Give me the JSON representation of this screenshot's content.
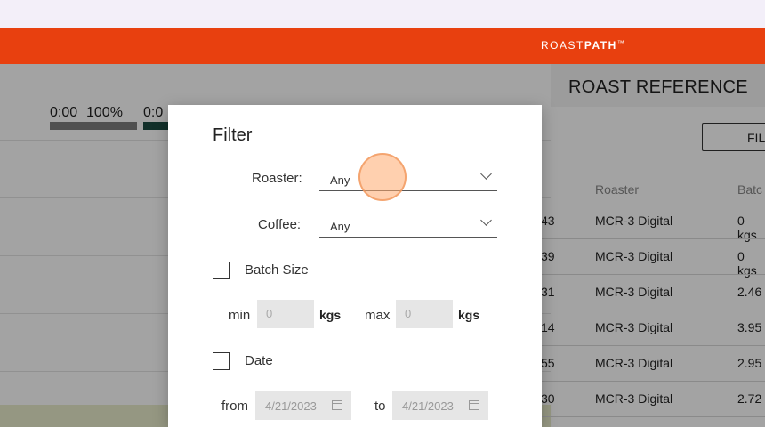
{
  "app": {
    "logo_light": "ROAST",
    "logo_bold": "PATH",
    "logo_tm": "™"
  },
  "background": {
    "progress": [
      {
        "time": "0:00",
        "percent": "100%",
        "bar_color": "#7d7d7d"
      },
      {
        "time": "0:0",
        "bar_color": "#1f4d44"
      }
    ]
  },
  "reference": {
    "title": "ROAST REFERENCE",
    "filter_button": "FIL",
    "columns": [
      "Roaster",
      "Batc"
    ],
    "rows": [
      {
        "id": "43",
        "roaster": "MCR-3 Digital",
        "batch": "0 kgs"
      },
      {
        "id": "39",
        "roaster": "MCR-3 Digital",
        "batch": "0 kgs"
      },
      {
        "id": "31",
        "roaster": "MCR-3 Digital",
        "batch": "2.46"
      },
      {
        "id": "14",
        "roaster": "MCR-3 Digital",
        "batch": "3.95"
      },
      {
        "id": "55",
        "roaster": "MCR-3 Digital",
        "batch": "2.95"
      },
      {
        "id": "30",
        "roaster": "MCR-3 Digital",
        "batch": "2.72"
      }
    ]
  },
  "filter": {
    "title": "Filter",
    "roaster_label": "Roaster:",
    "roaster_value": "Any",
    "coffee_label": "Coffee:",
    "coffee_value": "Any",
    "batch_size_label": "Batch Size",
    "min_label": "min",
    "min_value": "0",
    "max_label": "max",
    "max_value": "0",
    "unit": "kgs",
    "date_label": "Date",
    "from_label": "from",
    "from_value": "4/21/2023",
    "to_label": "to",
    "to_value": "4/21/2023"
  },
  "colors": {
    "brand": "#e8400f",
    "overlay": "rgba(0,0,0,0.36)"
  }
}
